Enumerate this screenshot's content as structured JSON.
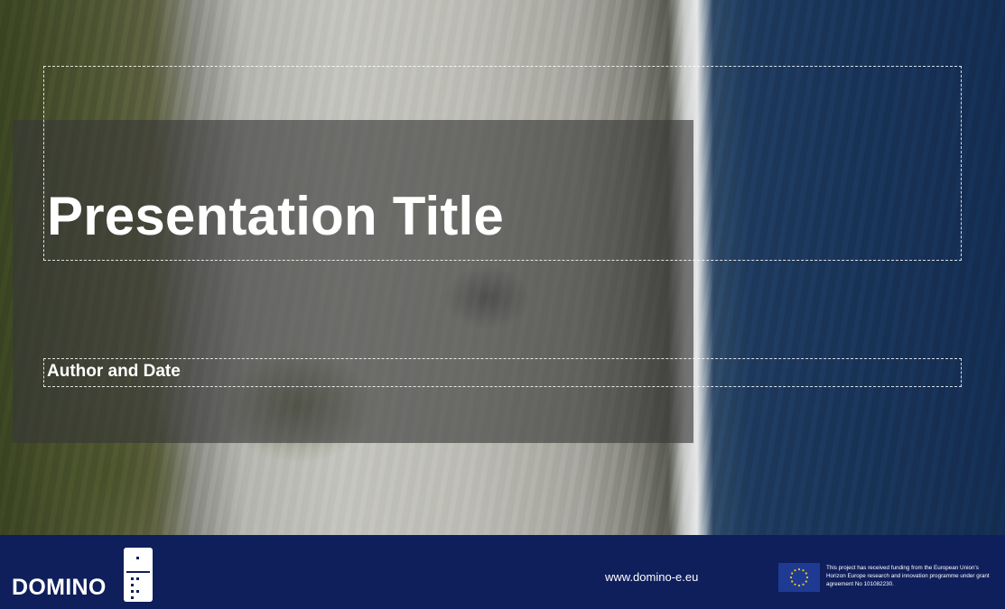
{
  "slide": {
    "title": "Presentation Title",
    "subtitle": "Author and Date"
  },
  "footer": {
    "logo_text": "DOMINO",
    "website": "www.domino-e.eu",
    "funding_notice": "This project has received funding from the European Union's Horizon Europe research and innovation programme under grant agreement No 101082230."
  },
  "icons": {
    "logo": "domino-tile-icon",
    "eu_flag": "eu-flag-icon"
  },
  "colors": {
    "footer_bg": "#0f1f5c",
    "overlay": "#373737",
    "title_text": "#ffffff"
  }
}
